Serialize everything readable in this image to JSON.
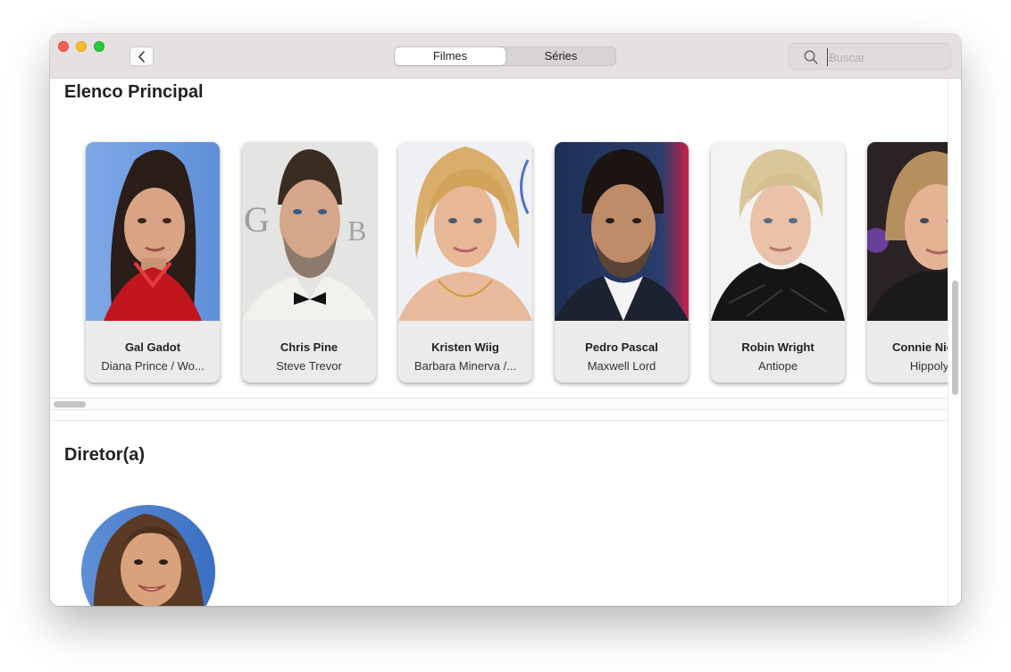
{
  "toolbar": {
    "segments": [
      "Filmes",
      "Séries"
    ],
    "search_placeholder": "Buscar",
    "search_value": ""
  },
  "sections": {
    "cast_title": "Elenco Principal",
    "director_title": "Diretor(a)"
  },
  "cast": [
    {
      "name": "Gal Gadot",
      "role": "Diana Prince / Wo..."
    },
    {
      "name": "Chris Pine",
      "role": "Steve Trevor"
    },
    {
      "name": "Kristen Wiig",
      "role": "Barbara Minerva /..."
    },
    {
      "name": "Pedro Pascal",
      "role": "Maxwell Lord"
    },
    {
      "name": "Robin Wright",
      "role": "Antiope"
    },
    {
      "name": "Connie Nielsen",
      "role": "Hippolyta"
    }
  ],
  "colors": {
    "titlebar": "#e6e1e1",
    "card": "#ebebeb",
    "traffic_close": "#fe5f57",
    "traffic_minimize": "#febc2e",
    "traffic_maximize": "#28c840"
  }
}
